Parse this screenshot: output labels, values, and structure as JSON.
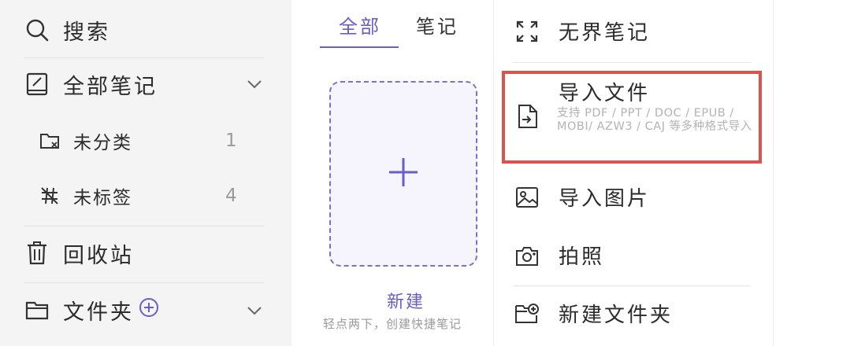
{
  "sidebar": {
    "search_label": "搜索",
    "all_notes_label": "全部笔记",
    "uncategorized_label": "未分类",
    "uncategorized_count": "1",
    "untagged_label": "未标签",
    "untagged_count": "4",
    "trash_label": "回收站",
    "folders_label": "文件夹"
  },
  "notes": {
    "tabs": [
      {
        "label": "全部",
        "active": true
      },
      {
        "label": "笔记",
        "active": false
      }
    ],
    "new_label": "新建",
    "new_hint": "轻点两下，创建快捷笔记"
  },
  "menu": {
    "items": [
      {
        "label": "无界笔记",
        "icon": "expand-icon"
      },
      {
        "label": "导入文件",
        "icon": "import-file-icon",
        "description": "支持 PDF / PPT / DOC / EPUB / MOBI/ AZW3 / CAJ 等多种格式导入",
        "highlighted": true
      },
      {
        "label": "导入图片",
        "icon": "image-icon"
      },
      {
        "label": "拍照",
        "icon": "camera-icon"
      },
      {
        "label": "新建文件夹",
        "icon": "new-folder-icon"
      }
    ]
  },
  "colors": {
    "accent": "#6a5cc9",
    "highlight_border": "#d9534f",
    "sidebar_bg": "#f4f4f4"
  }
}
